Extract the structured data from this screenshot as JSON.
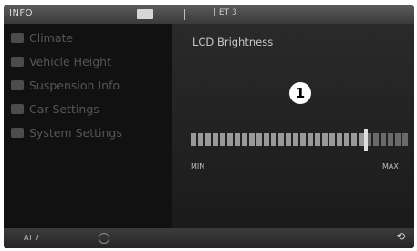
{
  "topbar": {
    "title": "INFO",
    "status": "|  ET 3"
  },
  "menu": {
    "items": [
      {
        "label": "Climate",
        "icon": "climate-icon"
      },
      {
        "label": "Vehicle Height",
        "icon": "car-height-icon"
      },
      {
        "label": "Suspension Info",
        "icon": "suspension-icon"
      },
      {
        "label": "Car Settings",
        "icon": "car-settings-icon"
      },
      {
        "label": "System Settings",
        "icon": "system-settings-icon"
      }
    ]
  },
  "panel": {
    "heading": "LCD Brightness",
    "callout": "1",
    "min_label": "MIN",
    "max_label": "MAX",
    "brightness_level": 0.8,
    "segments": 30
  },
  "bottombar": {
    "left_text": "AT 7"
  },
  "colors": {
    "background": "#0c0c0c",
    "panel": "#222222",
    "text": "#c8c8c8"
  }
}
